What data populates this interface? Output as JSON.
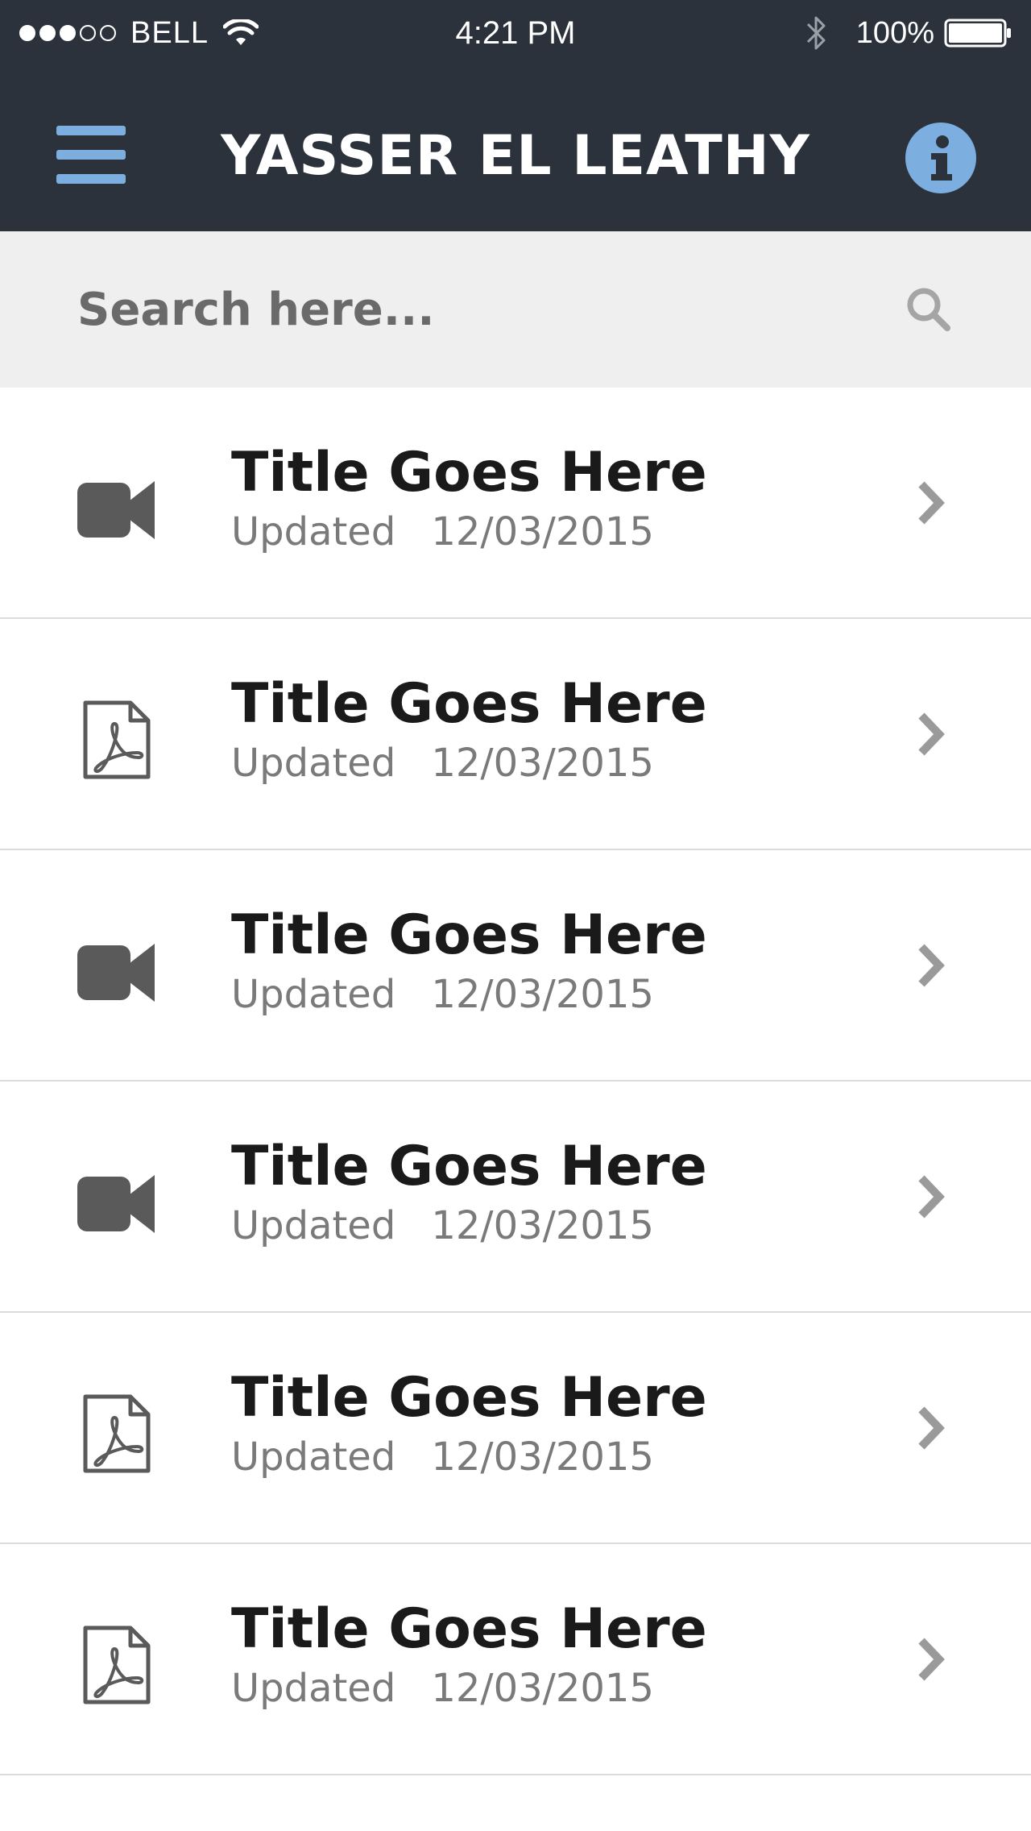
{
  "status_bar": {
    "carrier": "BELL",
    "time": "4:21 PM",
    "battery": "100%",
    "signal_filled": 3,
    "signal_total": 5
  },
  "navbar": {
    "title": "YASSER EL LEATHY",
    "menu_icon": "hamburger-menu-icon",
    "info_icon": "info-icon"
  },
  "search": {
    "placeholder": "Search here...",
    "value": ""
  },
  "list": {
    "items": [
      {
        "type": "video",
        "icon": "video-camera-icon",
        "title": "Title Goes Here",
        "updated_label": "Updated",
        "date": "12/03/2015"
      },
      {
        "type": "pdf",
        "icon": "pdf-document-icon",
        "title": "Title Goes Here",
        "updated_label": "Updated",
        "date": "12/03/2015"
      },
      {
        "type": "video",
        "icon": "video-camera-icon",
        "title": "Title Goes Here",
        "updated_label": "Updated",
        "date": "12/03/2015"
      },
      {
        "type": "video",
        "icon": "video-camera-icon",
        "title": "Title Goes Here",
        "updated_label": "Updated",
        "date": "12/03/2015"
      },
      {
        "type": "pdf",
        "icon": "pdf-document-icon",
        "title": "Title Goes Here",
        "updated_label": "Updated",
        "date": "12/03/2015"
      },
      {
        "type": "pdf",
        "icon": "pdf-document-icon",
        "title": "Title Goes Here",
        "updated_label": "Updated",
        "date": "12/03/2015"
      }
    ]
  },
  "colors": {
    "header_bg": "#2c323b",
    "accent": "#7daee0",
    "search_bg": "#efefef",
    "icon_gray": "#5a5a5a",
    "chevron_gray": "#9a9a9a",
    "divider": "#dcdcdc"
  }
}
